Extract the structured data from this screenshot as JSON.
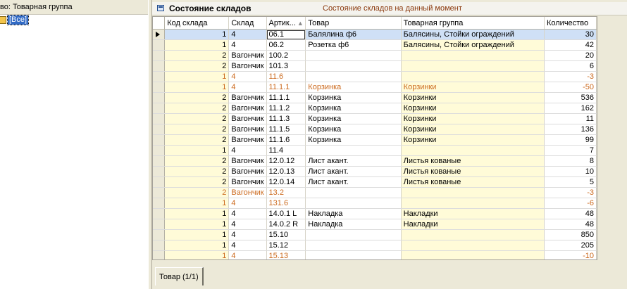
{
  "left_panel": {
    "header": "во: Товарная группа",
    "tree_root": "[Все]"
  },
  "panel": {
    "title": "Состояние складов",
    "subtitle": "Состояние складов на данный момент"
  },
  "table": {
    "columns": [
      "Код склада",
      "Склад",
      "Артик...",
      "Товар",
      "Товарная группа",
      "Количество"
    ],
    "rows": [
      [
        "1",
        "4",
        "06.1",
        "Балялина ф6",
        "Балясины, Стойки ограждений",
        "30"
      ],
      [
        "1",
        "4",
        "06.2",
        "Розетка ф6",
        "Балясины, Стойки ограждений",
        "42"
      ],
      [
        "2",
        "Вагончик",
        "100.2",
        "",
        "",
        "20"
      ],
      [
        "2",
        "Вагончик",
        "101.3",
        "",
        "",
        "6"
      ],
      [
        "1",
        "4",
        "11.6",
        "",
        "",
        "-3"
      ],
      [
        "1",
        "4",
        "11.1.1",
        "Корзинка",
        "Корзинки",
        "-50"
      ],
      [
        "2",
        "Вагончик",
        "11.1.1",
        "Корзинка",
        "Корзинки",
        "536"
      ],
      [
        "2",
        "Вагончик",
        "11.1.2",
        "Корзинка",
        "Корзинки",
        "162"
      ],
      [
        "2",
        "Вагончик",
        "11.1.3",
        "Корзинка",
        "Корзинки",
        "11"
      ],
      [
        "2",
        "Вагончик",
        "11.1.5",
        "Корзинка",
        "Корзинки",
        "136"
      ],
      [
        "2",
        "Вагончик",
        "11.1.6",
        "Корзинка",
        "Корзинки",
        "99"
      ],
      [
        "1",
        "4",
        "11.4",
        "",
        "",
        "7"
      ],
      [
        "2",
        "Вагончик",
        "12.0.12",
        "Лист акант.",
        "Листья кованые",
        "8"
      ],
      [
        "2",
        "Вагончик",
        "12.0.13",
        "Лист акант.",
        "Листья кованые",
        "10"
      ],
      [
        "2",
        "Вагончик",
        "12.0.14",
        "Лист акант.",
        "Листья кованые",
        "5"
      ],
      [
        "2",
        "Вагончик",
        "13.2",
        "",
        "",
        "-3"
      ],
      [
        "1",
        "4",
        "131.6",
        "",
        "",
        "-6"
      ],
      [
        "1",
        "4",
        "14.0.1 L",
        "Накладка",
        "Накладки",
        "48"
      ],
      [
        "1",
        "4",
        "14.0.2 R",
        "Накладка",
        "Накладки",
        "48"
      ],
      [
        "1",
        "4",
        "15.10",
        "",
        "",
        "850"
      ],
      [
        "1",
        "4",
        "15.12",
        "",
        "",
        "205"
      ],
      [
        "1",
        "4",
        "15.13",
        "",
        "",
        "-10"
      ]
    ]
  },
  "tabs": [
    "Товар (1/1)"
  ],
  "colors": {
    "negative_text": "#cc6a1e",
    "group_column_bg": "#fffbd8",
    "selection": "#316ac5",
    "subtitle": "#8b3a0e"
  }
}
